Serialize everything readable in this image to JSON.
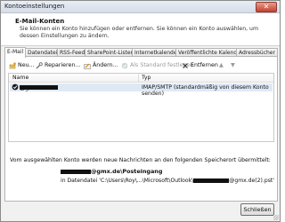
{
  "window": {
    "title": "Kontoeinstellungen",
    "close_glyph": "✕"
  },
  "header": {
    "title": "E-Mail-Konten",
    "description": "Sie können ein Konto hinzufügen oder entfernen. Sie können ein Konto auswählen, um dessen Einstellungen zu ändern."
  },
  "tabs": [
    {
      "label": "E-Mail",
      "active": true
    },
    {
      "label": "Datendateien"
    },
    {
      "label": "RSS-Feeds"
    },
    {
      "label": "SharePoint-Listen"
    },
    {
      "label": "Internetkalender"
    },
    {
      "label": "Veröffentlichte Kalender"
    },
    {
      "label": "Adressbücher"
    }
  ],
  "toolbar": {
    "new_label": "Neu...",
    "repair_label": "Reparieren...",
    "change_label": "Ändern...",
    "default_label": "Als Standard festlegen",
    "remove_label": "Entfernen",
    "up_glyph": "▲",
    "down_glyph": "▼"
  },
  "table": {
    "headers": {
      "name": "Name",
      "type": "Typ"
    },
    "rows": [
      {
        "name_suffix": "@gmx.de",
        "type": "IMAP/SMTP (standardmäßig von diesem Konto senden)"
      }
    ]
  },
  "info_text": "Vom ausgewählten Konto werden neue Nachrichten an den folgenden Speicherort übermittelt:",
  "store": {
    "name_suffix": "@gmx.de\\Posteingang",
    "path_prefix": "in Datendatei 'C:\\Users\\Roy\\...\\Microsoft\\Outlook\\",
    "path_suffix": "@gmx.de(2).pst'"
  },
  "footer": {
    "close_label": "Schließen"
  },
  "icons": [
    "close-icon",
    "new-icon",
    "repair-icon",
    "change-icon",
    "default-icon",
    "remove-icon",
    "up-icon",
    "down-icon",
    "check-icon"
  ]
}
